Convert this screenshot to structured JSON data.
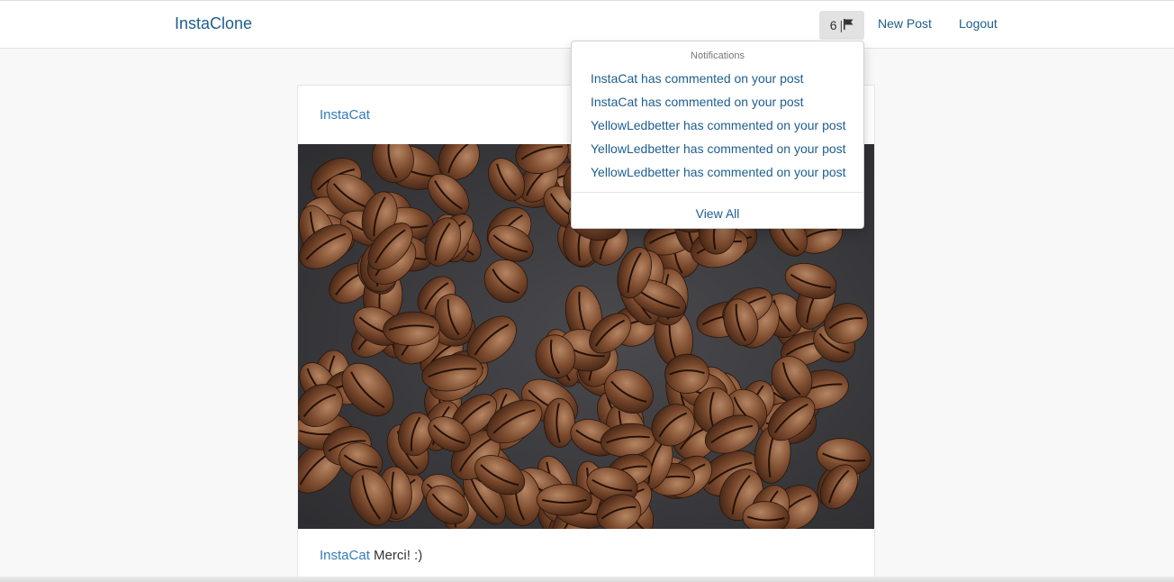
{
  "navbar": {
    "brand": "InstaClone",
    "notification_count": "6",
    "notification_separator": "|",
    "notification_icon": "flag-icon",
    "new_post_label": "New Post",
    "logout_label": "Logout"
  },
  "notifications": {
    "header": "Notifications",
    "items": [
      "InstaCat has commented on your post",
      "InstaCat has commented on your post",
      "YellowLedbetter has commented on your post",
      "YellowLedbetter has commented on your post",
      "YellowLedbetter has commented on your post"
    ],
    "view_all_label": "View All"
  },
  "post": {
    "author": "InstaCat",
    "image_subject": "coffee beans",
    "caption_user": "InstaCat",
    "caption_text": "Merci! :)"
  },
  "colors": {
    "link": "#1d5e8f",
    "username": "#337ab7",
    "page_background": "#f8f8f8",
    "toggle_background": "#e2e2e2"
  }
}
